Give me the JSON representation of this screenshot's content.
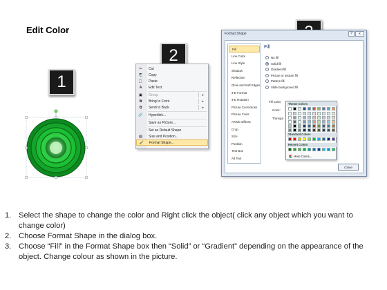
{
  "page": {
    "title": "Edit Color"
  },
  "steps": [
    "1",
    "2",
    "3"
  ],
  "context_menu": {
    "items": [
      {
        "label": "Cut",
        "icon": "scissors-icon",
        "glyph": "✂",
        "underline": "t",
        "submenu": false,
        "disabled": false,
        "highlight": false
      },
      {
        "label": "Copy",
        "icon": "copy-icon",
        "glyph": "⎘",
        "submenu": false,
        "disabled": false,
        "highlight": false
      },
      {
        "label": "Paste",
        "icon": "paste-icon",
        "glyph": "📋",
        "submenu": false,
        "disabled": false,
        "highlight": false
      },
      {
        "label": "Edit Text",
        "icon": "edit-text-icon",
        "glyph": "A",
        "submenu": false,
        "disabled": false,
        "highlight": false,
        "divider_after": true
      },
      {
        "label": "Group",
        "icon": "group-icon",
        "glyph": "▣",
        "submenu": true,
        "disabled": true,
        "highlight": false
      },
      {
        "label": "Bring to Front",
        "icon": "bring-front-icon",
        "glyph": "⧉",
        "submenu": true,
        "disabled": false,
        "highlight": false
      },
      {
        "label": "Send to Back",
        "icon": "send-back-icon",
        "glyph": "⧉",
        "submenu": true,
        "disabled": false,
        "highlight": false,
        "divider_after": true
      },
      {
        "label": "Hyperlink...",
        "icon": "hyperlink-icon",
        "glyph": "🔗",
        "submenu": false,
        "disabled": false,
        "highlight": false,
        "divider_after": true
      },
      {
        "label": "Save as Picture...",
        "icon": "",
        "glyph": "",
        "submenu": false,
        "disabled": false,
        "highlight": false,
        "divider_after": true
      },
      {
        "label": "Set as Default Shape",
        "icon": "",
        "glyph": "",
        "submenu": false,
        "disabled": false,
        "highlight": false
      },
      {
        "label": "Size and Position...",
        "icon": "size-position-icon",
        "glyph": "▤",
        "submenu": false,
        "disabled": false,
        "highlight": false
      },
      {
        "label": "Format Shape...",
        "icon": "format-shape-icon",
        "glyph": "🖌",
        "submenu": false,
        "disabled": false,
        "highlight": true
      }
    ]
  },
  "dialog": {
    "title": "Format Shape",
    "help": "?",
    "close_x": "x",
    "nav": [
      "Fill",
      "Line Color",
      "Line Style",
      "Shadow",
      "Reflection",
      "Glow and Soft Edges",
      "3-D Format",
      "3-D Rotation",
      "Picture Corrections",
      "Picture Color",
      "Artistic Effects",
      "Crop",
      "Size",
      "Position",
      "Text Box",
      "Alt Text"
    ],
    "nav_active": "Fill",
    "panel": {
      "heading": "Fill",
      "options": [
        {
          "label": "No fill",
          "type": "radio",
          "checked": false
        },
        {
          "label": "Solid fill",
          "type": "radio",
          "checked": true
        },
        {
          "label": "Gradient fill",
          "type": "radio",
          "checked": false
        },
        {
          "label": "Picture or texture fill",
          "type": "radio",
          "checked": false
        },
        {
          "label": "Pattern fill",
          "type": "radio",
          "checked": false
        },
        {
          "label": "Slide background fill",
          "type": "radio",
          "checked": false
        }
      ],
      "fill_color_label": "Fill Color",
      "color_label": "Color:",
      "transparency_label": "Transpa"
    },
    "close_button": "Close"
  },
  "palette": {
    "theme_title": "Theme Colors",
    "standard_title": "Standard Colors",
    "recent_title": "Recent Colors",
    "more_colors": "More Colors...",
    "theme_top": [
      "#ffffff",
      "#000000",
      "#eeece1",
      "#1f497d",
      "#4f81bd",
      "#c0504d",
      "#9bbb59",
      "#8064a2",
      "#4bacc6",
      "#f79646"
    ],
    "standard": [
      "#c00000",
      "#ff0000",
      "#ffc000",
      "#ffff00",
      "#92d050",
      "#00b050",
      "#00b0f0",
      "#0070c0",
      "#002060",
      "#7030a0"
    ],
    "recent": [
      "#006600",
      "#339933",
      "#33cc33",
      "#00b050",
      "#009999",
      "#0070c0",
      "#003399",
      "#00ccff",
      "#0099cc",
      "#00cc66"
    ]
  },
  "instructions": [
    {
      "num": "1.",
      "text": "Select the shape to change the color and Right click the object( click any object which you want to change color)"
    },
    {
      "num": "2.",
      "text": "Choose Format Shape in the dialog box."
    },
    {
      "num": "3.",
      "text": "Choose “Fill” in the Format Shape box then “Solid” or “Gradient” depending on the appearance of the object. Change colour as shown in the picture."
    }
  ]
}
